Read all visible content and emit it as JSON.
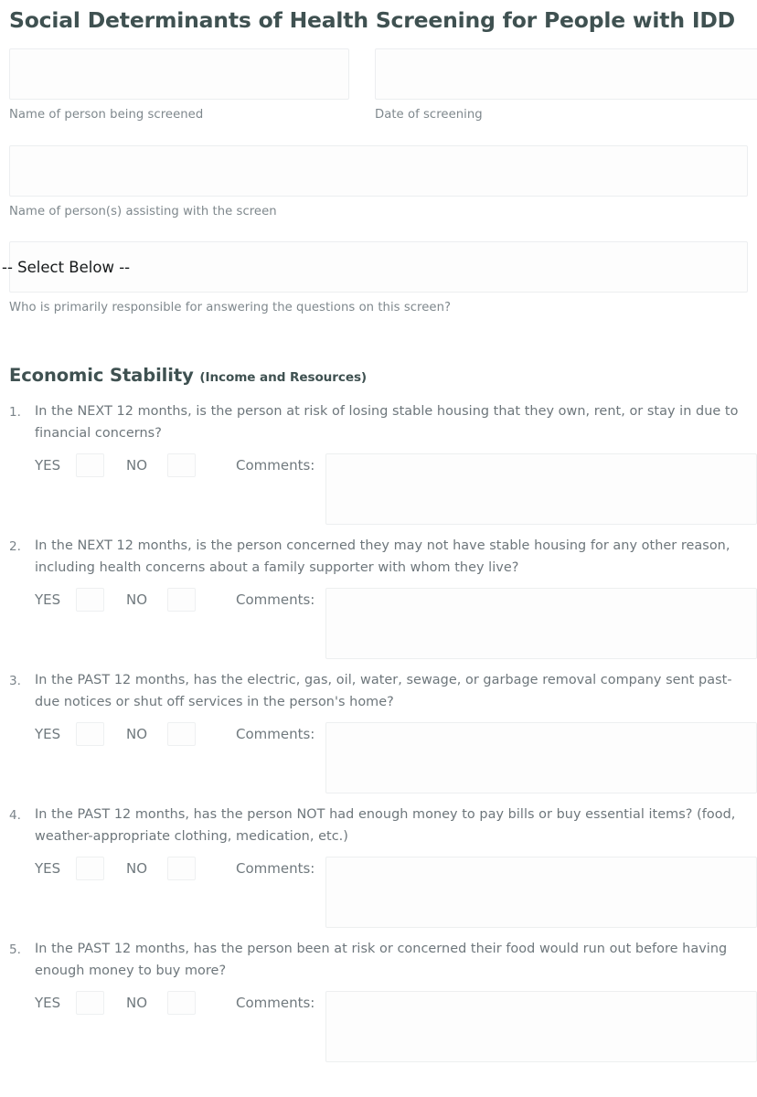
{
  "form": {
    "title": "Social Determinants of Health Screening for People with IDD",
    "fields": [
      {
        "caption": "Name of person being screened",
        "value": "",
        "type": "text"
      },
      {
        "caption": "Date of screening",
        "value": "",
        "type": "text"
      },
      {
        "caption": "Name of person(s) assisting with the screen",
        "value": "",
        "type": "text"
      }
    ],
    "select": {
      "value": "-- Select Below --",
      "caption": "Who is primarily responsible for answering the questions on this screen?"
    }
  },
  "section": {
    "heading": "Economic Stability",
    "subheading": "(Income and Resources)"
  },
  "answer_labels": {
    "yes": "YES",
    "no": "NO",
    "comments": "Comments:"
  },
  "questions": [
    {
      "number": "1.",
      "text": "In the NEXT 12 months, is the person at risk of losing stable housing that they own, rent, or stay in due to financial concerns?",
      "yes": "",
      "no": "",
      "comments": ""
    },
    {
      "number": "2.",
      "text": "In the NEXT 12 months, is the person concerned they may not have stable housing for any other reason, including health concerns about a family supporter with whom they live?",
      "yes": "",
      "no": "",
      "comments": ""
    },
    {
      "number": "3.",
      "text": "In the PAST 12 months, has the electric, gas, oil, water, sewage, or garbage removal company sent past-due notices or shut off services in the person's home?",
      "yes": "",
      "no": "",
      "comments": ""
    },
    {
      "number": "4.",
      "text": "In the PAST 12 months, has the person NOT had enough money to pay bills or buy essential items? (food, weather-appropriate clothing, medication, etc.)",
      "yes": "",
      "no": "",
      "comments": ""
    },
    {
      "number": "5.",
      "text": "In the PAST 12 months, has the person been at risk or concerned their food would run out before having enough money to buy more?",
      "yes": "",
      "no": "",
      "comments": ""
    }
  ],
  "colors": {
    "heading": "#3f5151",
    "body_text": "#6d767b",
    "caption": "#7f888d",
    "field_border": "#eceef0",
    "field_bg": "#fdfdfd",
    "page_bg": "#ffffff"
  }
}
